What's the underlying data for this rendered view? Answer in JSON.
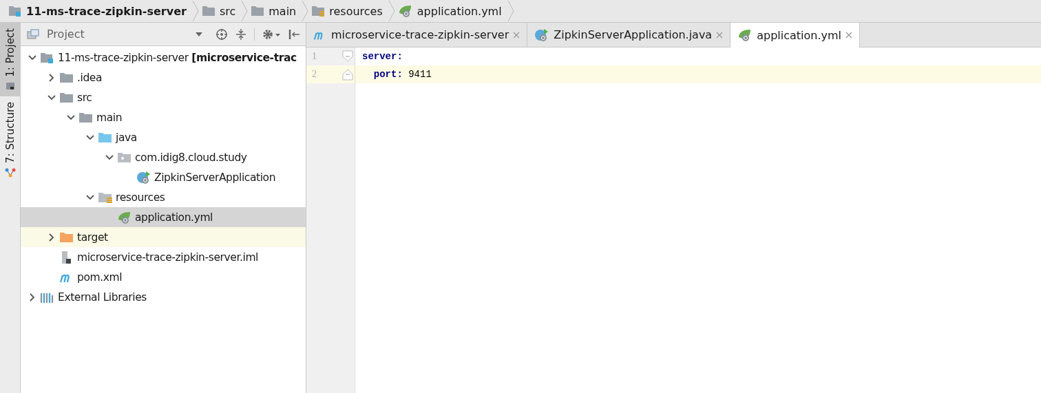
{
  "breadcrumbs": [
    {
      "label": "11-ms-trace-zipkin-server",
      "kind": "module"
    },
    {
      "label": "src",
      "kind": "folder"
    },
    {
      "label": "main",
      "kind": "folder"
    },
    {
      "label": "resources",
      "kind": "resources"
    },
    {
      "label": "application.yml",
      "kind": "yml"
    }
  ],
  "tool_strip": [
    {
      "label": "1: Project",
      "selected": true,
      "kind": "project"
    },
    {
      "label": "7: Structure",
      "selected": false,
      "kind": "structure"
    }
  ],
  "project_panel": {
    "title": "Project",
    "tree": [
      {
        "label": "11-ms-trace-zipkin-server **[microservice-trac**",
        "kind": "module",
        "expanded": true,
        "selected": false,
        "excluded": false,
        "children": [
          {
            "label": ".idea",
            "kind": "folder",
            "expanded": false,
            "selected": false,
            "excluded": false
          },
          {
            "label": "src",
            "kind": "folder",
            "expanded": true,
            "selected": false,
            "excluded": false,
            "children": [
              {
                "label": "main",
                "kind": "folder",
                "expanded": true,
                "selected": false,
                "excluded": false,
                "children": [
                  {
                    "label": "java",
                    "kind": "source",
                    "expanded": true,
                    "selected": false,
                    "excluded": false,
                    "children": [
                      {
                        "label": "com.idig8.cloud.study",
                        "kind": "package",
                        "expanded": true,
                        "selected": false,
                        "excluded": false,
                        "children": [
                          {
                            "label": "ZipkinServerApplication",
                            "kind": "class",
                            "selected": false,
                            "excluded": false
                          }
                        ]
                      }
                    ]
                  },
                  {
                    "label": "resources",
                    "kind": "resources",
                    "expanded": true,
                    "selected": false,
                    "excluded": false,
                    "children": [
                      {
                        "label": "application.yml",
                        "kind": "yml",
                        "selected": true,
                        "excluded": false
                      }
                    ]
                  }
                ]
              }
            ]
          },
          {
            "label": "target",
            "kind": "target",
            "expanded": false,
            "selected": false,
            "excluded": true
          },
          {
            "label": "microservice-trace-zipkin-server.iml",
            "kind": "iml",
            "selected": false,
            "excluded": false
          },
          {
            "label": "pom.xml",
            "kind": "maven",
            "selected": false,
            "excluded": false
          }
        ]
      },
      {
        "label": "External Libraries",
        "kind": "libraries",
        "expanded": false,
        "selected": false,
        "excluded": false
      }
    ]
  },
  "editor": {
    "tabs": [
      {
        "label": "microservice-trace-zipkin-server",
        "kind": "maven",
        "selected": false
      },
      {
        "label": "ZipkinServerApplication.java",
        "kind": "class",
        "selected": false
      },
      {
        "label": "application.yml",
        "kind": "yml",
        "selected": true
      }
    ],
    "lines": [
      {
        "number": "1",
        "key": "server:",
        "current": false
      },
      {
        "number": "2",
        "key": "  port:",
        "value": " 9411",
        "current": true
      }
    ]
  }
}
